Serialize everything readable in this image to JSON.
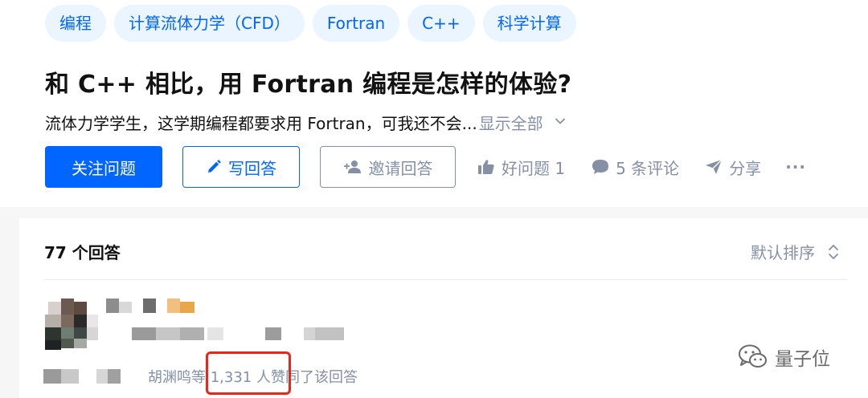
{
  "question": {
    "topics": [
      "编程",
      "计算流体力学（CFD）",
      "Fortran",
      "C++",
      "科学计算"
    ],
    "title": "和 C++ 相比，用 Fortran 编程是怎样的体验?",
    "excerpt": "流体力学学生，这学期编程都要求用 Fortran，可我还不会...",
    "show_all_label": "显示全部",
    "actions": {
      "follow_label": "关注问题",
      "write_label": "写回答",
      "invite_label": "邀请回答",
      "good_question_label": "好问题 1",
      "comments_label": "5 条评论",
      "share_label": "分享",
      "more_label": "···"
    }
  },
  "answers": {
    "count_label": "77 个回答",
    "sort_label": "默认排序",
    "first_answer": {
      "voters_text": "胡渊鸣等 1,331 人赞同了该回答"
    }
  },
  "watermark": {
    "text": "量子位"
  },
  "colors": {
    "accent": "#0066ff",
    "muted": "#8590a6",
    "highlight": "#e8261a"
  }
}
